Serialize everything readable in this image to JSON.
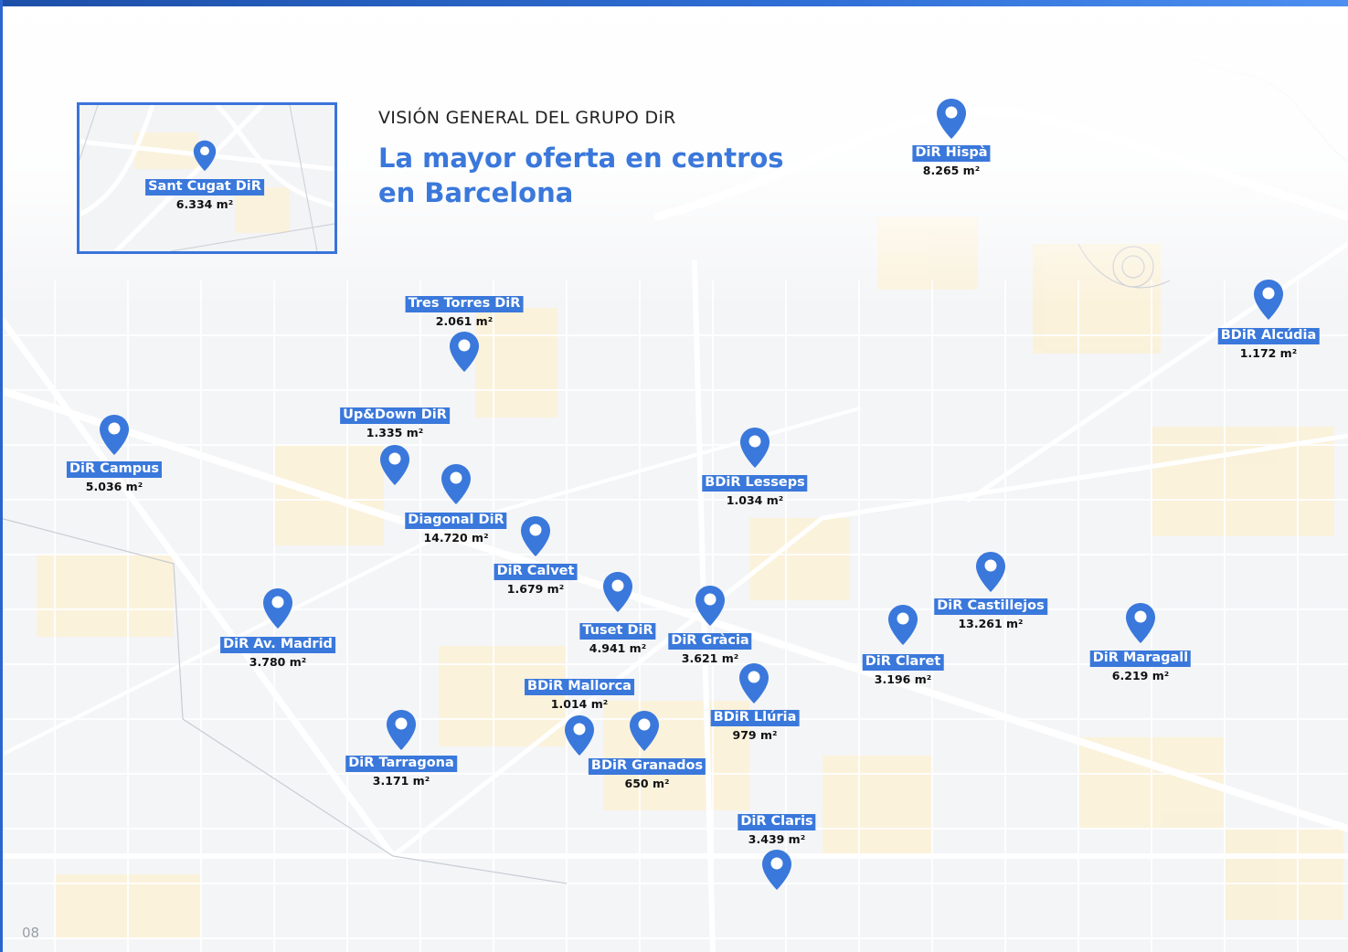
{
  "header": {
    "section": "VISIÓN GENERAL DEL GRUPO DiR",
    "headline": [
      "La mayor oferta en centros",
      "en Barcelona"
    ]
  },
  "inset": {
    "name": "Sant Cugat DiR",
    "area": "6.334 m²"
  },
  "locations": [
    {
      "name": "DiR Hispà",
      "area": "8.265 m²"
    },
    {
      "name": "BDiR Alcúdia",
      "area": "1.172 m²"
    },
    {
      "name": "Tres Torres DiR",
      "area": "2.061 m²"
    },
    {
      "name": "Up&Down DiR",
      "area": "1.335 m²"
    },
    {
      "name": "DiR Campus",
      "area": "5.036 m²"
    },
    {
      "name": "Diagonal DiR",
      "area": "14.720 m²"
    },
    {
      "name": "BDiR Lesseps",
      "area": "1.034 m²"
    },
    {
      "name": "DiR Calvet",
      "area": "1.679 m²"
    },
    {
      "name": "DiR Av. Madrid",
      "area": "3.780 m²"
    },
    {
      "name": "Tuset DiR",
      "area": "4.941 m²"
    },
    {
      "name": "DiR Gràcia",
      "area": "3.621 m²"
    },
    {
      "name": "DiR Castillejos",
      "area": "13.261 m²"
    },
    {
      "name": "DiR Claret",
      "area": "3.196 m²"
    },
    {
      "name": "DiR Maragall",
      "area": "6.219 m²"
    },
    {
      "name": "BDiR Mallorca",
      "area": "1.014 m²"
    },
    {
      "name": "BDiR Llúria",
      "area": "979 m²"
    },
    {
      "name": "DiR Tarragona",
      "area": "3.171 m²"
    },
    {
      "name": "BDiR Granados",
      "area": "650 m²"
    },
    {
      "name": "DiR Claris",
      "area": "3.439 m²"
    }
  ],
  "page_number": "08",
  "colors": {
    "brand_blue": "#3a78db",
    "frame_blue": "#3a74da",
    "map_bg": "#f4f5f7",
    "street": "#ffffff",
    "district": "#fbf1d6"
  },
  "icons": {
    "marker": "map-pin-icon"
  }
}
